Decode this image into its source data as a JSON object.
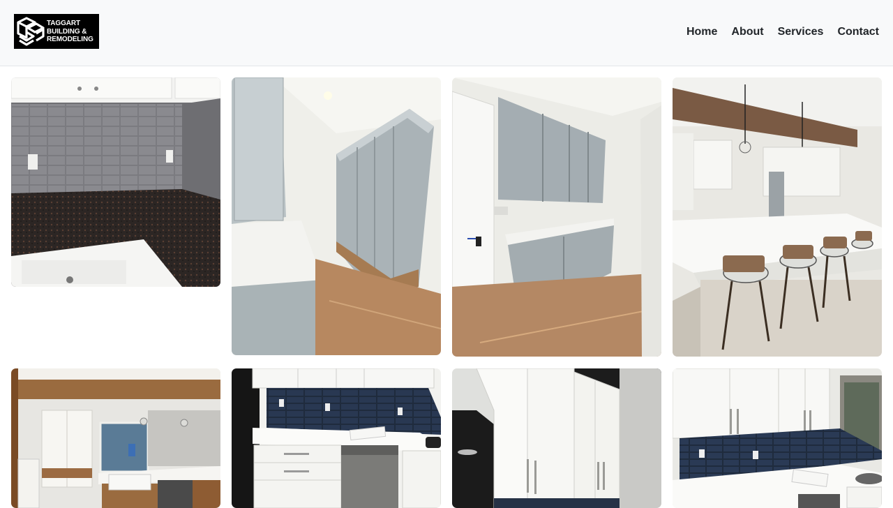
{
  "brand": {
    "line1": "TAGGART",
    "line2": "BUILDING &",
    "line3": "REMODELING",
    "logo_bg": "#000000"
  },
  "nav": {
    "items": [
      "Home",
      "About",
      "Services",
      "Contact"
    ]
  },
  "gallery": {
    "photos": [
      {
        "name": "kitchen-backsplash-granite-photo"
      },
      {
        "name": "mudroom-lockers-photo"
      },
      {
        "name": "mudroom-cabinets-photo"
      },
      {
        "name": "kitchen-island-pendants-photo"
      },
      {
        "name": "open-kitchen-view-photo"
      },
      {
        "name": "navy-backsplash-dishwasher-photo"
      },
      {
        "name": "white-cabinets-photo"
      },
      {
        "name": "white-cabinets-navy-tile-photo"
      }
    ]
  },
  "colors": {
    "header_bg": "#f8f9fa",
    "nav_text": "#212529"
  }
}
